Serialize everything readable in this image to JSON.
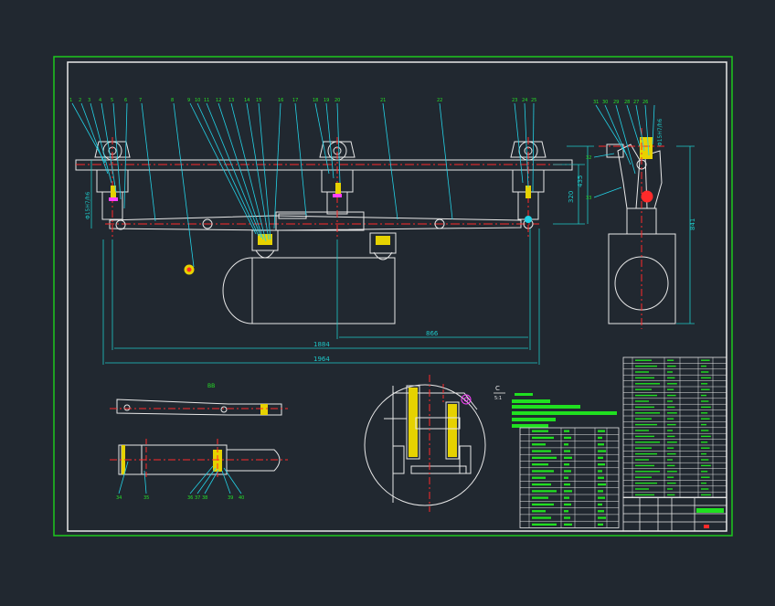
{
  "colors": {
    "background": "#212830",
    "frame_green": "#1ec81e",
    "line_white": "#e8e8e8",
    "center_red": "#ff2a2a",
    "section_yellow": "#e6d200",
    "dim_cyan": "#1ec8c8",
    "leader_cyan": "#23d2e6",
    "label_green": "#26e026",
    "accent_magenta": "#ff40ff",
    "block_green": "#20e020"
  },
  "dimensions": {
    "overall_length": "1964",
    "inner_length": "1884",
    "right_offset": "866",
    "height_a": "320",
    "height_b": "435",
    "side_height": "841",
    "fit_left": "Φ15H7/h6",
    "fit_right": "Φ15H7/h6"
  },
  "views": {
    "detail_b_label": "BB",
    "detail_c_label": "C",
    "detail_c_scale": "5:1"
  },
  "parts_list": {
    "left_table_rows": 15,
    "right_table_rows": 24
  }
}
